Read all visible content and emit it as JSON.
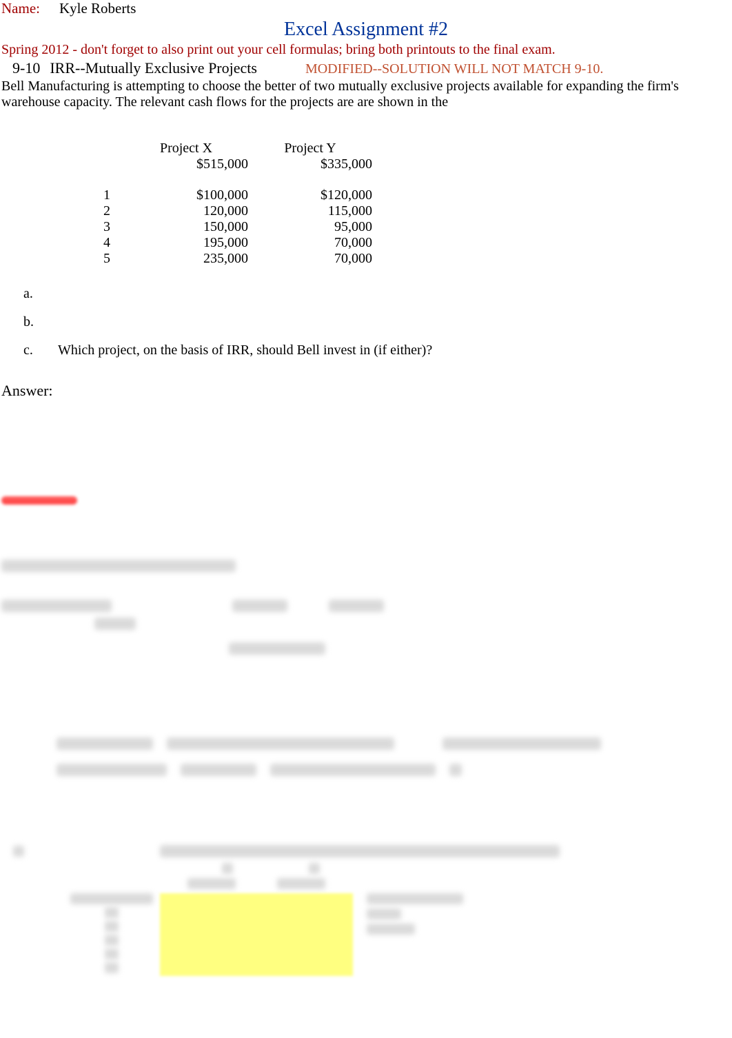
{
  "header": {
    "name_label": "Name:",
    "name_value": "Kyle Roberts",
    "title": "Excel Assignment #2",
    "subtitle": "Spring 2012 - don't forget to also print out your cell formulas; bring both printouts to the final exam.",
    "problem_num": "9-10",
    "problem_title": "IRR--Mutually Exclusive Projects",
    "modified_note": "MODIFIED--SOLUTION WILL NOT MATCH 9-10.",
    "description": "Bell Manufacturing is attempting to choose the better of two mutually exclusive projects available for expanding the firm's warehouse capacity. The relevant cash flows for the projects are are shown in the"
  },
  "table": {
    "proj_x_label": "Project X",
    "proj_y_label": "Project Y",
    "initial_x": "$515,000",
    "initial_y": "$335,000",
    "rows": [
      {
        "year": "1",
        "x": "$100,000",
        "y": "$120,000"
      },
      {
        "year": "2",
        "x": "120,000",
        "y": "115,000"
      },
      {
        "year": "3",
        "x": "150,000",
        "y": "95,000"
      },
      {
        "year": "4",
        "x": "195,000",
        "y": "70,000"
      },
      {
        "year": "5",
        "x": "235,000",
        "y": "70,000"
      }
    ]
  },
  "questions": {
    "a": {
      "letter": "a.",
      "text": ""
    },
    "b": {
      "letter": "b.",
      "text": ""
    },
    "c": {
      "letter": "c.",
      "text": "Which project, on the basis of IRR, should Bell invest in (if either)?"
    }
  },
  "answer_label": "Answer:"
}
